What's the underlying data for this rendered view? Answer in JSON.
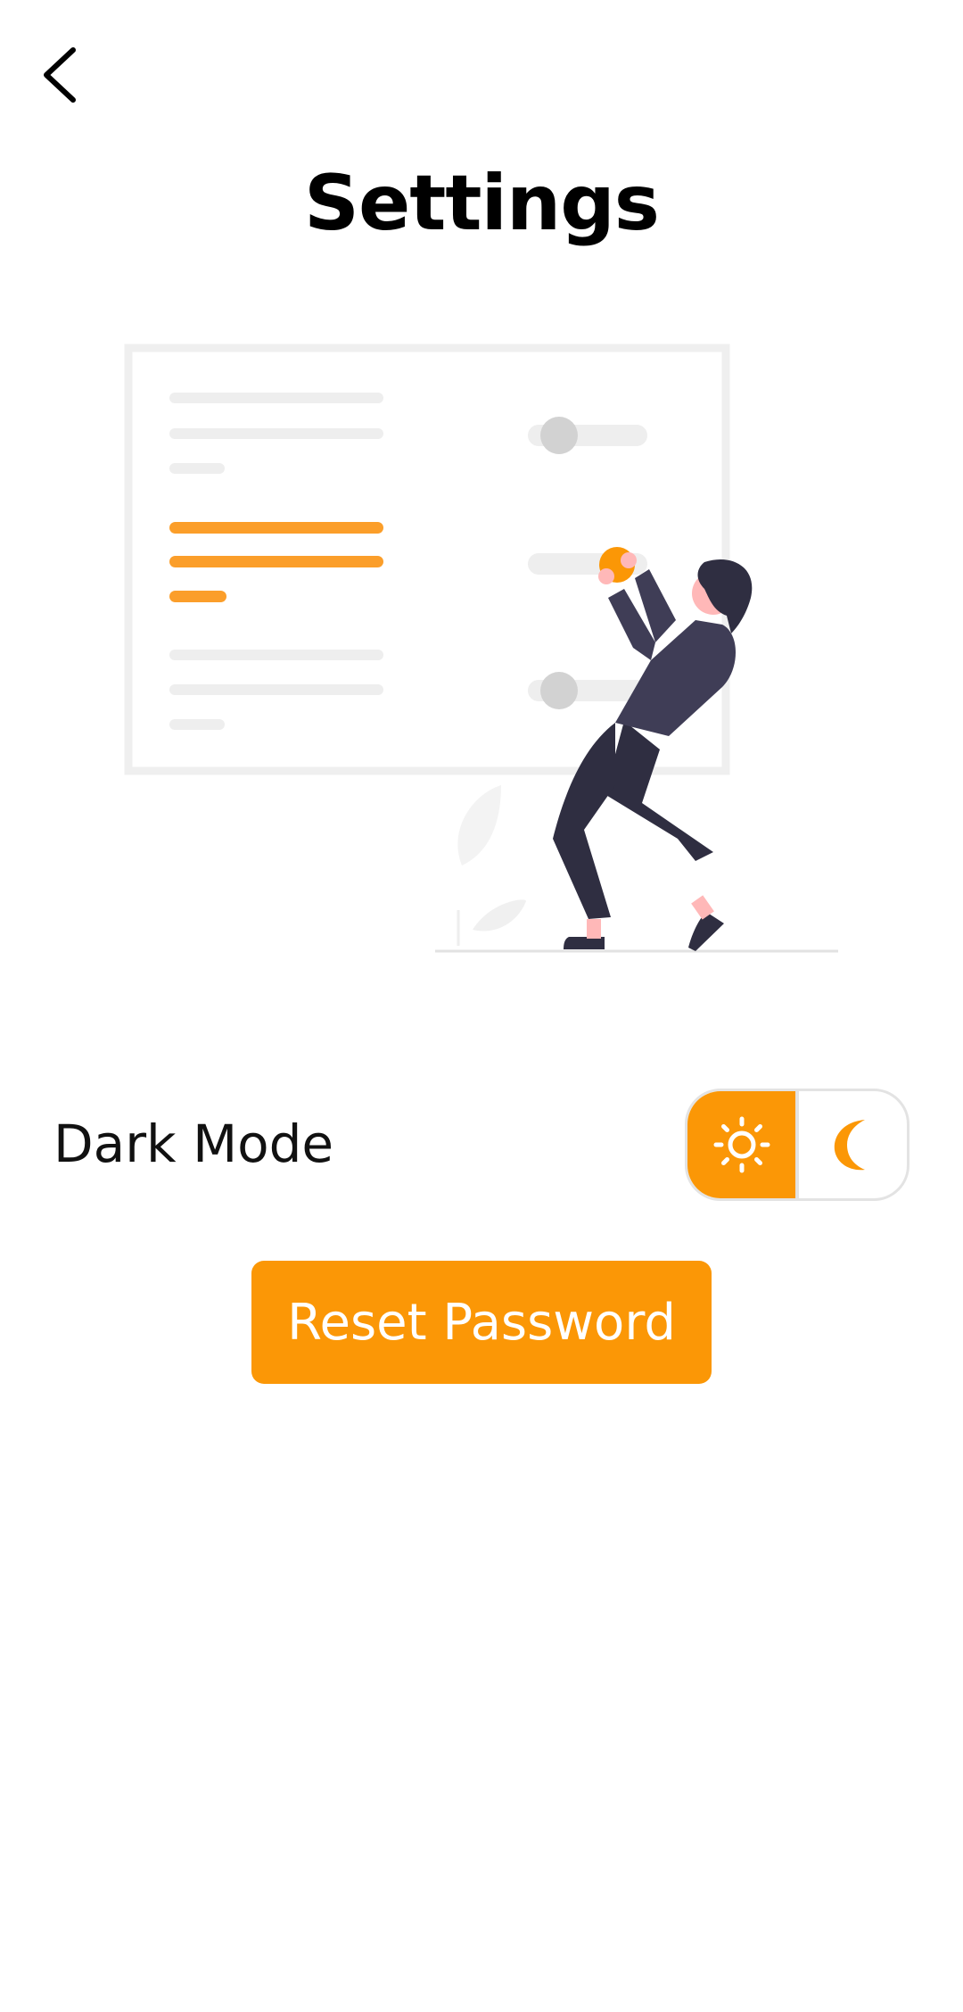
{
  "header": {
    "back_icon": "chevron-left-icon",
    "title": "Settings"
  },
  "illustration": {
    "name": "settings-illustration",
    "accent_color": "#fb9706"
  },
  "settings": {
    "dark_mode": {
      "label": "Dark Mode",
      "light_icon": "sun-icon",
      "dark_icon": "moon-icon",
      "selected": "light"
    }
  },
  "actions": {
    "reset_password_label": "Reset Password"
  },
  "colors": {
    "accent": "#fb9706",
    "text": "#000000",
    "background": "#ffffff"
  }
}
